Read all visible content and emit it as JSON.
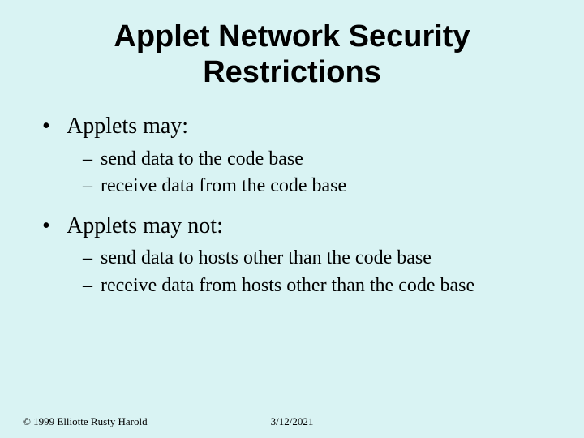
{
  "title": "Applet Network Security Restrictions",
  "bullets": {
    "0": {
      "heading": "Applets may:",
      "sub": {
        "0": "send data to the code base",
        "1": "receive data from the code base"
      }
    },
    "1": {
      "heading": "Applets may not:",
      "sub": {
        "0": "send data to hosts other than the code base",
        "1": "receive data from hosts other than the code base"
      }
    }
  },
  "footer": {
    "copyright": "© 1999 Elliotte Rusty Harold",
    "date": "3/12/2021"
  }
}
